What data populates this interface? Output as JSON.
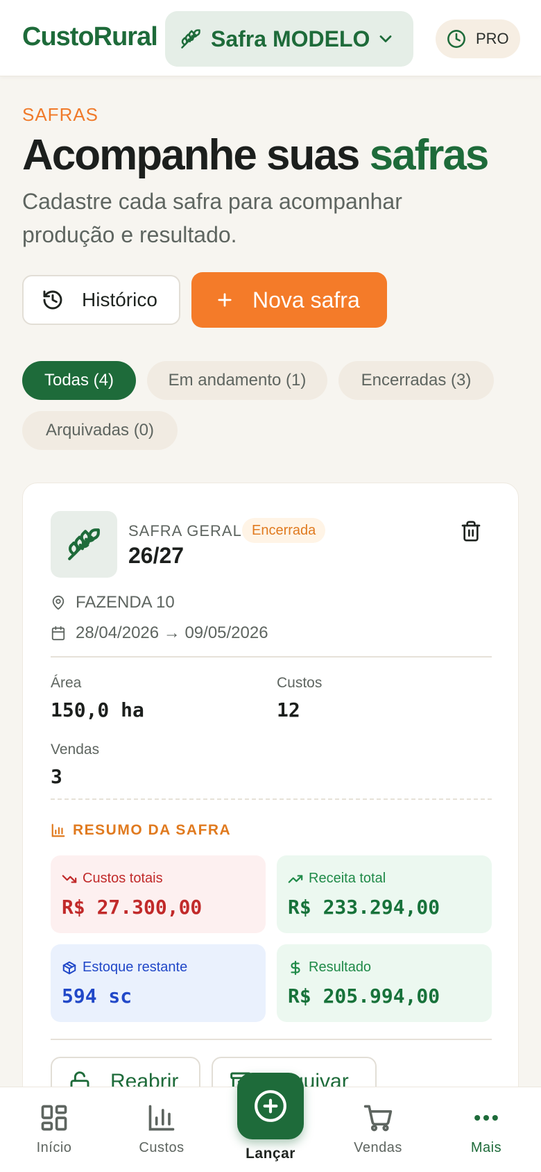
{
  "header": {
    "brand": "CustoRural",
    "safra_selector": "Safra MODELO",
    "plan_badge": "PRO"
  },
  "intro": {
    "eyebrow": "SAFRAS",
    "title_main": "Acompanhe suas",
    "title_accent": "safras",
    "subtitle": "Cadastre cada safra para acompanhar produção e resultado."
  },
  "actions": {
    "history": "Histórico",
    "new_safra": "Nova safra"
  },
  "filters": [
    {
      "label": "Todas (4)",
      "active": true
    },
    {
      "label": "Em andamento (1)",
      "active": false
    },
    {
      "label": "Encerradas (3)",
      "active": false
    },
    {
      "label": "Arquivadas (0)",
      "active": false
    }
  ],
  "card": {
    "kind": "SAFRA GERAL",
    "status": "Encerrada",
    "name": "26/27",
    "farm": "FAZENDA 10",
    "period": "28/04/2026 → 09/05/2026",
    "stats": {
      "area_label": "Área",
      "area_value": "150,0 ha",
      "costs_label": "Custos",
      "costs_value": "12",
      "sales_label": "Vendas",
      "sales_value": "3"
    },
    "summary_title": "RESUMO DA SAFRA",
    "summary": {
      "costs_label": "Custos totais",
      "costs_value": "R$ 27.300,00",
      "revenue_label": "Receita total",
      "revenue_value": "R$ 233.294,00",
      "stock_label": "Estoque restante",
      "stock_value": "594 sc",
      "result_label": "Resultado",
      "result_value": "R$ 205.994,00"
    },
    "reopen": "Reabrir",
    "archive": "Arquivar"
  },
  "bottom_nav": {
    "home": "Início",
    "costs": "Custos",
    "launch": "Lançar",
    "sales": "Vendas",
    "more": "Mais"
  },
  "colors": {
    "brand_green": "#1e6b3a",
    "accent_orange": "#f47b29"
  }
}
